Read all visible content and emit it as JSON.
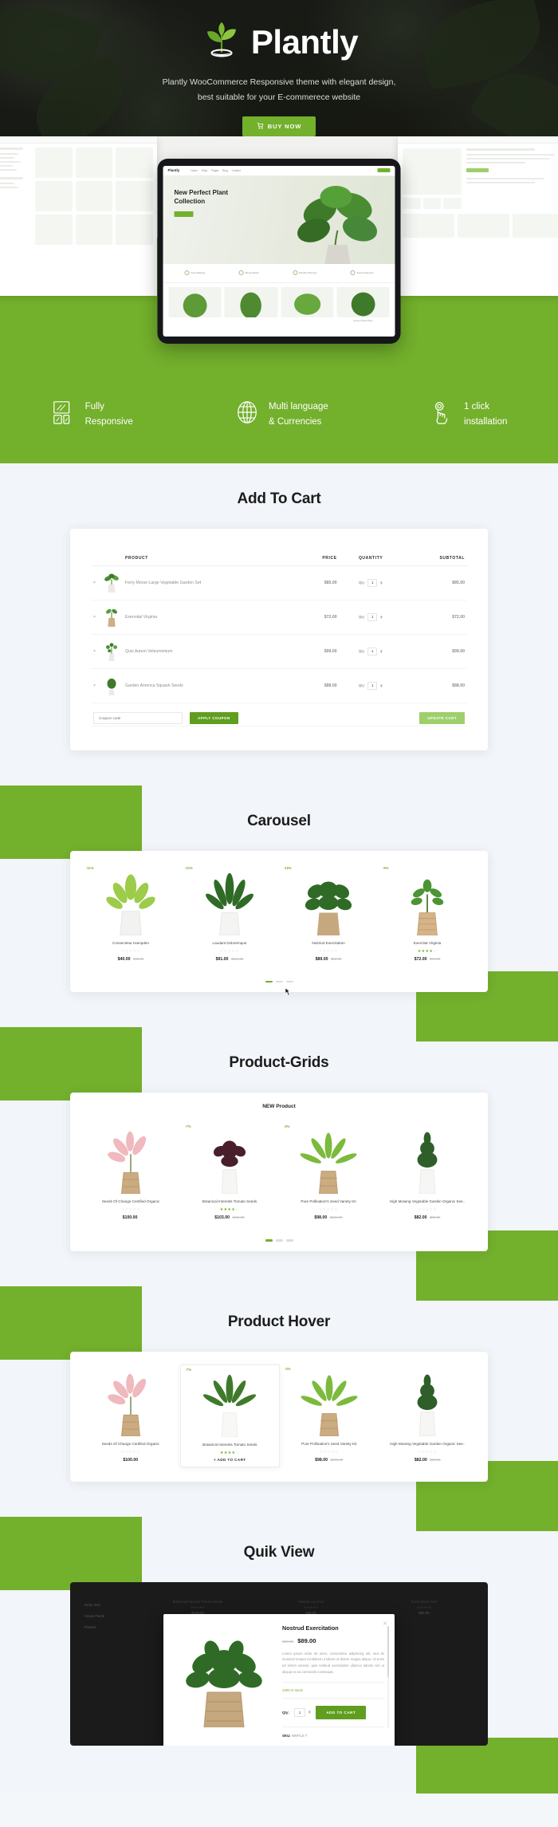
{
  "hero": {
    "brand": "Plantly",
    "logo_icon": "plant-leaf-logo",
    "subtitle_line1": "Plantly WooCommerce Responsive theme with elegant design,",
    "subtitle_line2": "best suitable for your E-commerece website",
    "buy_button": "BUY NOW",
    "cart_icon": "shopping-cart-icon"
  },
  "showcase": {
    "tablet": {
      "brand": "Plantly",
      "nav": [
        "Home",
        "Shop",
        "Pages",
        "Blog",
        "Contact"
      ],
      "hero_title_line1": "New Perfect Plant",
      "hero_title_line2": "Collection",
      "shop_button": "SHOP NOW",
      "features": [
        "Free Shipping",
        "Money Return",
        "Member Discount",
        "Secure Payment"
      ],
      "product_caption": "House Shape Plant"
    }
  },
  "features": [
    {
      "icon": "responsive-devices-icon",
      "line1": "Fully",
      "line2": "Responsive"
    },
    {
      "icon": "globe-icon",
      "line1": "Multi language",
      "line2": "& Currencies"
    },
    {
      "icon": "click-hand-icon",
      "line1": "1 click",
      "line2": "installation"
    }
  ],
  "cart_section": {
    "title": "Add To Cart",
    "columns": [
      "",
      "",
      "PRODUCT",
      "PRICE",
      "QUANTITY",
      "SUBTOTAL"
    ],
    "rows": [
      {
        "remove": "×",
        "name": "Ferry Morse Large Vegetable Garden Set",
        "price": "$85.00",
        "qty_label": "Qty:",
        "qty": "1",
        "subtotal": "$85.00",
        "thumb": "fern-in-white-pot"
      },
      {
        "remove": "×",
        "name": "Exenoital Virginia",
        "price": "$72.00",
        "qty_label": "Qty:",
        "qty": "1",
        "subtotal": "$72.00",
        "thumb": "succulent-in-basket"
      },
      {
        "remove": "×",
        "name": "Quis Autem Veleumimium",
        "price": "$99.00",
        "qty_label": "Qty:",
        "qty": "1",
        "subtotal": "$99.00",
        "thumb": "leafy-plant-white-pot"
      },
      {
        "remove": "×",
        "name": "Garden America Squash Seeds",
        "price": "$88.00",
        "qty_label": "Qty:",
        "qty": "1",
        "subtotal": "$88.00",
        "thumb": "bushy-green-plant"
      }
    ],
    "coupon_placeholder": "Coupon code",
    "apply_coupon": "APPLY COUPON",
    "update_cart": "UPDATE CART"
  },
  "carousel_section": {
    "title": "Carousel",
    "products": [
      {
        "badge": "-11%",
        "name": "Consectetur Hampden",
        "rating": 0,
        "price": "$40.00",
        "old_price": "$45.00",
        "img": "light-green-fern-white-pot"
      },
      {
        "badge": "-21%",
        "name": "Laudant Doloremque",
        "rating": 0,
        "price": "$91.00",
        "old_price": "$110.00",
        "img": "snake-plant-white-pot"
      },
      {
        "badge": "-10%",
        "name": "Nostrud Exercitation",
        "rating": 0,
        "price": "$89.00",
        "old_price": "$99.00",
        "img": "broad-leaf-plant-burlap"
      },
      {
        "badge": "-9%",
        "name": "Exercitat Virginia",
        "rating": 4,
        "price": "$72.00",
        "old_price": "$79.00",
        "img": "succulent-woven-basket"
      }
    ],
    "dots": 3
  },
  "grid_section": {
    "title": "Product-Grids",
    "subtitle": "NEW Product",
    "products": [
      {
        "badge": "",
        "name": "Seeds Of Change Certified Organic",
        "rating": 0,
        "price": "$100.00",
        "old_price": "",
        "img": "pink-lily-burlap-pot"
      },
      {
        "badge": "-7%",
        "name": "Botanical Interests Tomato Seeds",
        "rating": 4,
        "price": "$103.00",
        "old_price": "$111.00",
        "img": "dark-purple-plant-white-pot"
      },
      {
        "badge": "-3%",
        "name": "Pure Pollination's Seed Variety Kit",
        "rating": 0,
        "price": "$98.00",
        "old_price": "$101.00",
        "img": "spider-plant-burlap"
      },
      {
        "badge": "",
        "name": "High Mowing Vegetable Garden Organic See..",
        "rating": 0,
        "price": "$82.00",
        "old_price": "$88.00",
        "img": "small-tree-white-pot"
      }
    ],
    "dots": 3
  },
  "hover_section": {
    "title": "Product Hover",
    "products": [
      {
        "badge": "",
        "name": "Seeds Of Change Certified Organic",
        "rating": 0,
        "price": "$100.00",
        "old_price": "",
        "img": "pink-lily-burlap-pot",
        "hovered": false
      },
      {
        "badge": "-7%",
        "name": "Botanical Interests Tomato Seeds",
        "rating": 4,
        "price": "",
        "old_price": "",
        "img": "aloe-plant-white-pot",
        "hovered": true,
        "add_to_cart": "+ ADD TO CART"
      },
      {
        "badge": "-3%",
        "name": "Pure Pollination's Seed Variety Kit",
        "rating": 0,
        "price": "$98.00",
        "old_price": "$101.00",
        "img": "spider-plant-burlap",
        "hovered": false
      },
      {
        "badge": "",
        "name": "High Mowing Vegetable Garden Organic See..",
        "rating": 0,
        "price": "$82.00",
        "old_price": "$88.00",
        "img": "small-tree-white-pot",
        "hovered": false
      }
    ]
  },
  "quickview_section": {
    "title": "Quik View",
    "background_products": [
      {
        "name": "Botanical Interests Tomato Seeds",
        "price": "$103.00",
        "old_price": "$111.00"
      },
      {
        "name": "Nostrud Lorj Fern",
        "price": "$89.00",
        "old_price": "$99.00"
      },
      {
        "name": "Exerci Bank Fern",
        "price": "$82.00",
        "old_price": "$88.00"
      }
    ],
    "sidebar": [
      "Order Item",
      "House Plants",
      "Flowers"
    ],
    "modal": {
      "title": "Nostrud Exercitation",
      "old_price": "$99.00",
      "price": "$89.00",
      "description": "Lorem ipsum dolor sit amet, consectetur adipiscing elit, sed do eiusmod tempor incididunt ut labore et dolore magna aliqua. Ut enim ad minim veniam, quis nostrud exercitation ullamco laboris nisi ut aliquip ex ea commodo consequat.",
      "stock": "1000 in stock",
      "qty_label": "Qty:",
      "qty": "1",
      "add_to_cart": "ADD TO CART",
      "sku_label": "SKU:",
      "sku_value": "WHFLS-7",
      "close_icon": "close-icon",
      "image": "broad-leaf-plant-burlap"
    }
  },
  "colors": {
    "brand_green": "#73b02c",
    "dark_green": "#5f9e1f",
    "light_green": "#9ecf6b",
    "hero_dark": "#1d1f1c",
    "section_bg": "#f2f5f9"
  }
}
